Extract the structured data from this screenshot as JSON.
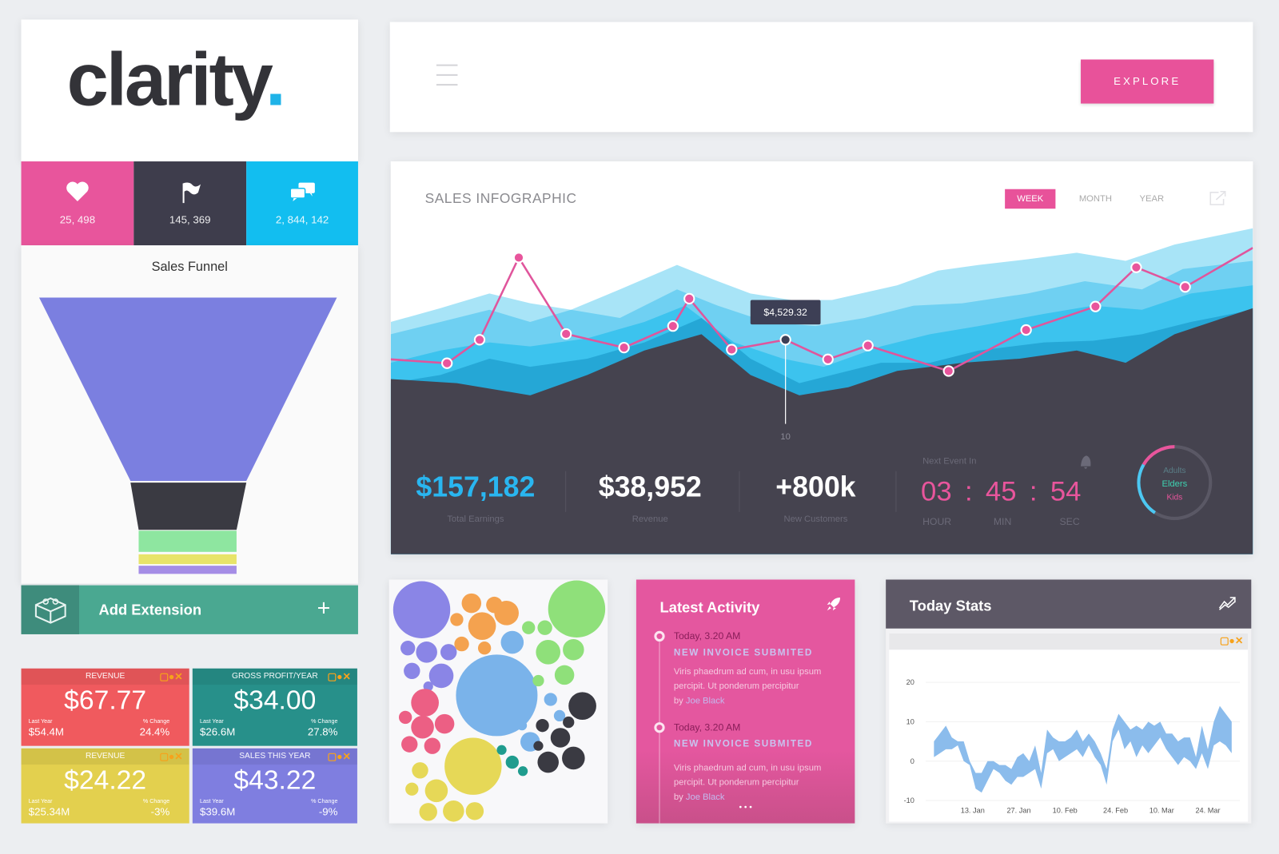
{
  "logo": {
    "text": "clarity",
    "dot": "."
  },
  "counters": [
    {
      "icon": "heart-icon",
      "value": "25, 498",
      "color": "#e8559c"
    },
    {
      "icon": "flag-icon",
      "value": "145, 369",
      "color": "#3e3d4c"
    },
    {
      "icon": "chat-bubbles-icon",
      "value": "2, 844, 142",
      "color": "#12bef0"
    }
  ],
  "funnel": {
    "title": "Sales Funnel",
    "stages_colors": [
      "#7b7fe0",
      "#3a3a42",
      "#8ee6a0",
      "#e8e46a",
      "#a58de6"
    ]
  },
  "extension": {
    "label": "Add Extension",
    "plus": "+"
  },
  "kpis": [
    {
      "title": "REVENUE",
      "value": "$67.77",
      "last_year_label": "Last Year",
      "last_year": "$54.4M",
      "change_label": "% Change",
      "change": "24.4%",
      "color": "#f05a5e"
    },
    {
      "title": "GROSS PROFIT/YEAR",
      "value": "$34.00",
      "last_year_label": "Last Year",
      "last_year": "$26.6M",
      "change_label": "% Change",
      "change": "27.8%",
      "color": "#27908a"
    },
    {
      "title": "REVENUE",
      "value": "$24.22",
      "last_year_label": "Last Year",
      "last_year": "$25.34M",
      "change_label": "% Change",
      "change": "-3%",
      "color": "#e3d04e"
    },
    {
      "title": "SALES THIS YEAR",
      "value": "$43.22",
      "last_year_label": "Last Year",
      "last_year": "$39.6M",
      "change_label": "% Change",
      "change": "-9%",
      "color": "#7f7ee0"
    }
  ],
  "header": {
    "explore_label": "EXPLORE",
    "accent": "#e8529a"
  },
  "sales": {
    "title": "SALES INFOGRAPHIC",
    "ranges": [
      "WEEK",
      "MONTH",
      "YEAR"
    ],
    "active_range": "WEEK",
    "tooltip": "$4,529.32",
    "marker_label": "10",
    "metrics": [
      {
        "value": "$157,182",
        "label": "Total Earnings"
      },
      {
        "value": "$38,952",
        "label": "Revenue"
      },
      {
        "value": "+800k",
        "label": "New Customers"
      }
    ],
    "countdown": {
      "title": "Next Event In",
      "hour": "03",
      "min": "45",
      "sec": "54",
      "sep": ":",
      "hour_label": "HOUR",
      "min_label": "MIN",
      "sec_label": "SEC"
    },
    "donut": {
      "labels": [
        "Adults",
        "Elders",
        "Kids"
      ]
    }
  },
  "chart_data": [
    {
      "type": "line",
      "series": [
        {
          "values": [
            33,
            31,
            43,
            85,
            46,
            39,
            50,
            64,
            38,
            43,
            33,
            40,
            27,
            48,
            60,
            80,
            70,
            90
          ]
        }
      ],
      "highlight_index": 9,
      "highlight_label": "$4,529.32"
    },
    {
      "type": "area",
      "title": "",
      "ylim": [
        -10,
        20
      ],
      "yticks": [
        20,
        10,
        0,
        -10
      ],
      "x_range": [
        "1 Jan",
        "30 Mar"
      ],
      "xticks": [
        "13. Jan",
        "27. Jan",
        "10. Feb",
        "24. Feb",
        "10. Mar",
        "24. Mar"
      ],
      "lower": [
        1,
        2,
        3,
        3,
        4,
        0,
        -1,
        -7,
        -8,
        -5,
        -2,
        -3,
        -5,
        -6,
        -4,
        -4,
        -3,
        -2,
        -7,
        2,
        3,
        0,
        1,
        2,
        3,
        1,
        4,
        1,
        -1,
        -6,
        5,
        8,
        3,
        5,
        1,
        4,
        2,
        4,
        6,
        3,
        1,
        -1,
        1,
        0,
        -2,
        2,
        -2,
        4,
        5,
        4,
        2
      ],
      "upper": [
        5,
        7,
        9,
        6,
        5,
        5,
        0,
        -3,
        -3,
        0,
        0,
        -1,
        -1,
        -2,
        1,
        2,
        0,
        4,
        -3,
        8,
        6,
        5,
        5,
        6,
        8,
        5,
        7,
        5,
        2,
        -2,
        8,
        12,
        10,
        8,
        9,
        8,
        10,
        9,
        10,
        7,
        7,
        5,
        6,
        6,
        1,
        9,
        3,
        10,
        14,
        12,
        10
      ],
      "color": "#8bbcec"
    }
  ],
  "activity": {
    "title": "Latest Activity",
    "items": [
      {
        "time": "Today, 3.20 AM",
        "title": "NEW INVOICE SUBMITED",
        "body": "Viris phaedrum ad cum, in usu ipsum percipit. Ut ponderum percipitur",
        "by": "by",
        "author": "Joe Black"
      },
      {
        "time": "Today, 3.20 AM",
        "title": "NEW INVOICE SUBMITED",
        "body": "Viris phaedrum ad cum, in usu ipsum percipit. Ut ponderum percipitur",
        "by": "by",
        "author": "Joe Black"
      }
    ],
    "more": "• • •"
  },
  "today_stats": {
    "title": "Today Stats"
  }
}
